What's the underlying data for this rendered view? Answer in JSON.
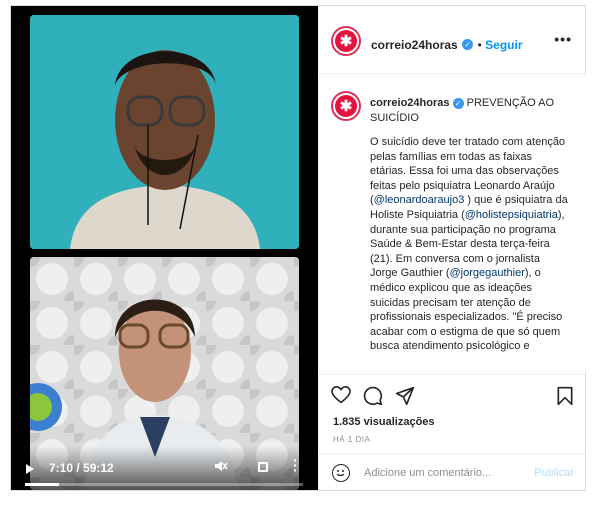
{
  "post": {
    "username": "correio24horas",
    "follow_label": "Seguir",
    "more_label": "•••"
  },
  "caption": {
    "title": "PREVENÇÃO AO SUICÍDIO",
    "body_1": "O suicídio deve ter tratado com atenção pelas famílias em todas as faixas etárias. Essa foi uma das observações feitas pelo psiquiatra Leonardo Araújo (",
    "mention_1": "@leonardoaraujo3",
    "body_2": " ) que é psiquiatra da Holiste Psiquiatria (",
    "mention_2": "@holistepsiquiatria",
    "body_3": "), durante sua participação no programa Saúde & Bem-Estar desta terça-feira (21). Em conversa com o jornalista Jorge Gauthier (",
    "mention_3": "@jorgegauthier",
    "body_4": "), o médico explicou que as ideações suicidas precisam ter atenção de profissionais especializados. \"É preciso acabar com o estigma de que só quem busca atendimento psicológico e"
  },
  "video": {
    "time_label": "7:10 / 59:12",
    "progress": 0.121
  },
  "stats": {
    "views_count": "1.835",
    "views_label": "visualizações",
    "posted_ago": "HÁ 1 DIA"
  },
  "comment": {
    "placeholder": "Adicione um comentário...",
    "publish_label": "Publicar"
  },
  "colors": {
    "accent": "#0095f6",
    "brand": "#e4123d",
    "publish_disabled": "#b2dffc"
  }
}
